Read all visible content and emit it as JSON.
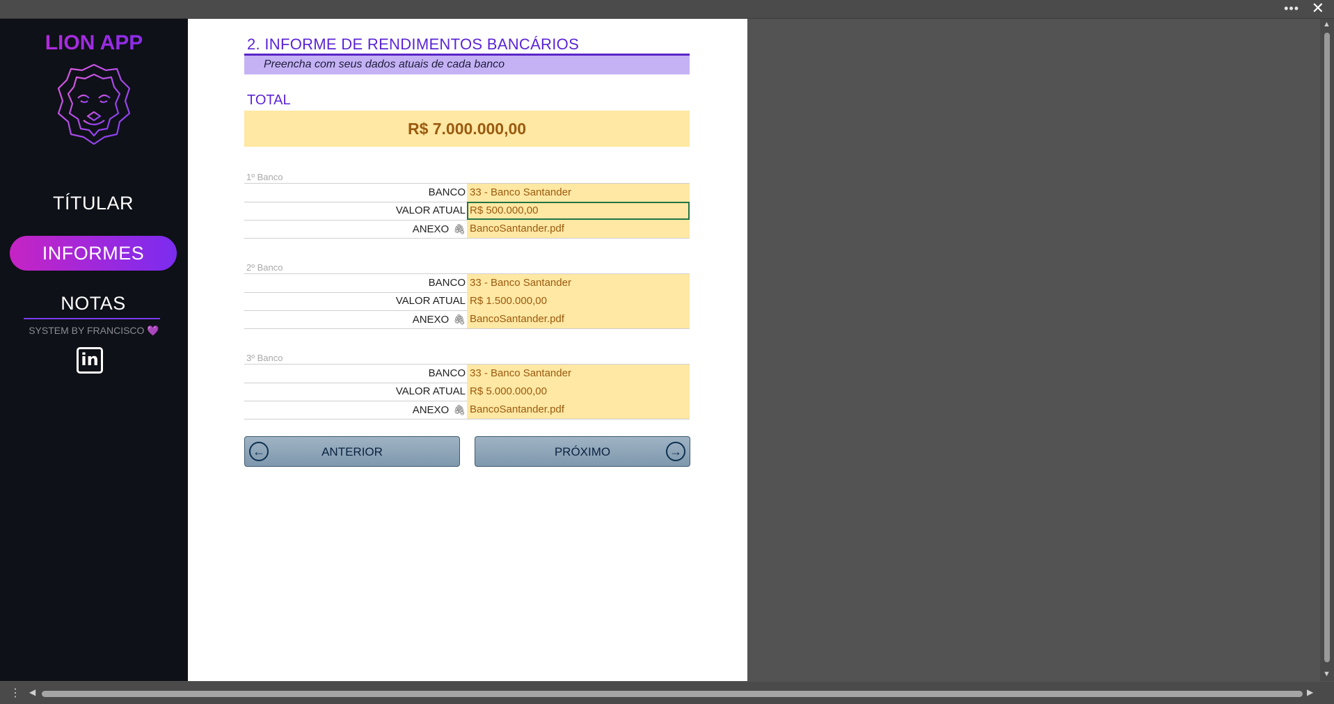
{
  "window": {
    "more_label": "•••",
    "close_label": "✕"
  },
  "sidebar": {
    "brand": "LION APP",
    "nav": [
      {
        "label": "TÍTULAR"
      },
      {
        "label": "INFORMES"
      },
      {
        "label": "NOTAS"
      }
    ],
    "credit": "SYSTEM BY FRANCISCO",
    "heart": "💜",
    "linkedin": "in"
  },
  "form": {
    "title": "2. INFORME DE RENDIMENTOS BANCÁRIOS",
    "subtitle": "Preencha com seus dados atuais de cada banco",
    "total_label": "TOTAL",
    "total_value": "R$ 7.000.000,00",
    "labels": {
      "banco": "BANCO",
      "valor": "VALOR ATUAL",
      "anexo": "ANEXO"
    },
    "banks": [
      {
        "heading": "1º Banco",
        "banco": "33 - Banco Santander",
        "valor": "R$ 500.000,00",
        "anexo": "BancoSantander.pdf"
      },
      {
        "heading": "2º Banco",
        "banco": "33 - Banco Santander",
        "valor": "R$ 1.500.000,00",
        "anexo": "BancoSantander.pdf"
      },
      {
        "heading": "3º Banco",
        "banco": "33 - Banco Santander",
        "valor": "R$ 5.000.000,00",
        "anexo": "BancoSantander.pdf"
      }
    ],
    "prev_button": "ANTERIOR",
    "next_button": "PRÓXIMO"
  }
}
